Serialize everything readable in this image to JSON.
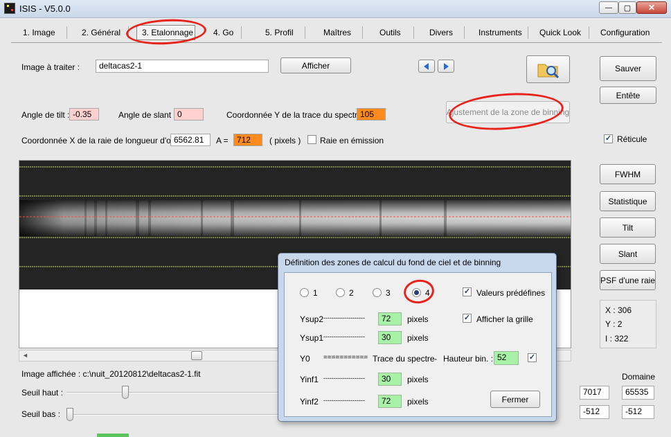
{
  "window": {
    "title": "ISIS - V5.0.0",
    "app_icon": "isis-icon"
  },
  "window_controls": {
    "minimize": "—",
    "maximize": "▢",
    "close": "✕"
  },
  "tabs": [
    {
      "label": "1. Image"
    },
    {
      "label": "2. Général"
    },
    {
      "label": "3. Etalonnage"
    },
    {
      "label": "4. Go"
    },
    {
      "label": "5. Profil"
    },
    {
      "label": "Maîtres"
    },
    {
      "label": "Outils"
    },
    {
      "label": "Divers"
    },
    {
      "label": "Instruments"
    },
    {
      "label": "Quick Look"
    },
    {
      "label": "Configuration"
    }
  ],
  "image_row": {
    "label": "Image à traiter :",
    "value": "deltacas2-1",
    "afficher": "Afficher"
  },
  "params": {
    "tilt_label": "Angle de tilt :",
    "tilt_value": "-0.35",
    "slant_label": "Angle de slant :",
    "slant_value": "0",
    "coordy_label": "Coordonnée Y de la trace du spectre :",
    "coordy_value": "105",
    "ajust_button": "Ajustement de la zone de binning",
    "coordx_label": "Coordonnée X de la raie de longueur d'onde",
    "coordx_value": "6562.81",
    "a_label": "A =",
    "a_value": "712",
    "pixels_label": "( pixels )",
    "emission_label": "Raie en émission"
  },
  "right_panel": {
    "sauver": "Sauver",
    "entete": "Entête",
    "reticule": "Réticule",
    "fwhm": "FWHM",
    "statistique": "Statistique",
    "tilt": "Tilt",
    "slant": "Slant",
    "psf": "PSF d'une raie",
    "x_readout": "X : 306",
    "y_readout": "Y : 2",
    "i_readout": "I : 322",
    "domaine_label": "Domaine",
    "seuil_haut_value": "7017",
    "domaine_haut": "65535",
    "seuil_bas_value": "-512",
    "domaine_bas": "-512"
  },
  "bottom": {
    "image_affichee": "Image affichée : c:\\nuit_20120812\\deltacas2-1.fit",
    "seuil_haut": "Seuil haut :",
    "seuil_bas": "Seuil bas :"
  },
  "dialog": {
    "title": "Définition des zones de calcul du fond de ciel et de binning",
    "radios": [
      "1",
      "2",
      "3",
      "4"
    ],
    "selected_radio": "4",
    "valeurs_predefinies": "Valeurs prédéfines",
    "afficher_grille": "Afficher la grille",
    "ysup2_label": "Ysup2",
    "ysup2_dashes": "--------------------",
    "ysup2_value": "72",
    "ysup1_label": "Ysup1",
    "ysup1_dashes": "--------------------",
    "ysup1_value": "30",
    "y0_label": "Y0",
    "y0_equals": "===========",
    "trace_label": "Trace du spectre",
    "dash": "-",
    "hauteur_label": "Hauteur bin. :",
    "hauteur_value": "52",
    "yinf1_label": "Yinf1",
    "yinf1_dashes": "--------------------",
    "yinf1_value": "30",
    "yinf2_label": "Yinf2",
    "yinf2_dashes": "--------------------",
    "yinf2_value": "72",
    "pixels": "pixels",
    "fermer": "Fermer"
  },
  "colors": {
    "accent_red_annotation": "#e8231b",
    "field_pink": "#ffd0d0",
    "field_orange": "#ff8a1e",
    "field_green": "#a8f2a8",
    "grid_yellow": "#d8e84a",
    "trace_red": "#ff4a3a"
  }
}
